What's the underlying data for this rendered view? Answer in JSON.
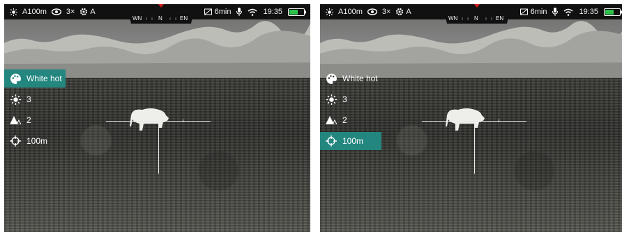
{
  "screens": [
    {
      "id": "left",
      "status": {
        "brightness_label": "A100m",
        "zoom_label": "3×",
        "calibration_label": "A",
        "record_time": "6min",
        "time": "19:35"
      },
      "compass": {
        "left": "WN",
        "center": "N",
        "right": "EN"
      },
      "menu": {
        "palette_label": "White hot",
        "brightness_value": "3",
        "contrast_value": "2",
        "distance_value": "100m",
        "selected": "palette"
      }
    },
    {
      "id": "right",
      "status": {
        "brightness_label": "A100m",
        "zoom_label": "3×",
        "calibration_label": "A",
        "record_time": "6min",
        "time": "19:35"
      },
      "compass": {
        "left": "WN",
        "center": "N",
        "right": "EN"
      },
      "menu": {
        "palette_label": "White hot",
        "brightness_value": "3",
        "contrast_value": "2",
        "distance_value": "100m",
        "selected": "distance"
      }
    }
  ],
  "colors": {
    "menu_selected": "#23867f",
    "battery": "#2ec04a",
    "compass_marker": "#d11a1a"
  },
  "icons": [
    "brightness-icon",
    "eye-icon",
    "settings-gear-icon",
    "record-icon",
    "microphone-icon",
    "wifi-icon",
    "battery-icon",
    "palette-icon",
    "sun-icon",
    "contrast-icon",
    "rangefinder-icon"
  ]
}
